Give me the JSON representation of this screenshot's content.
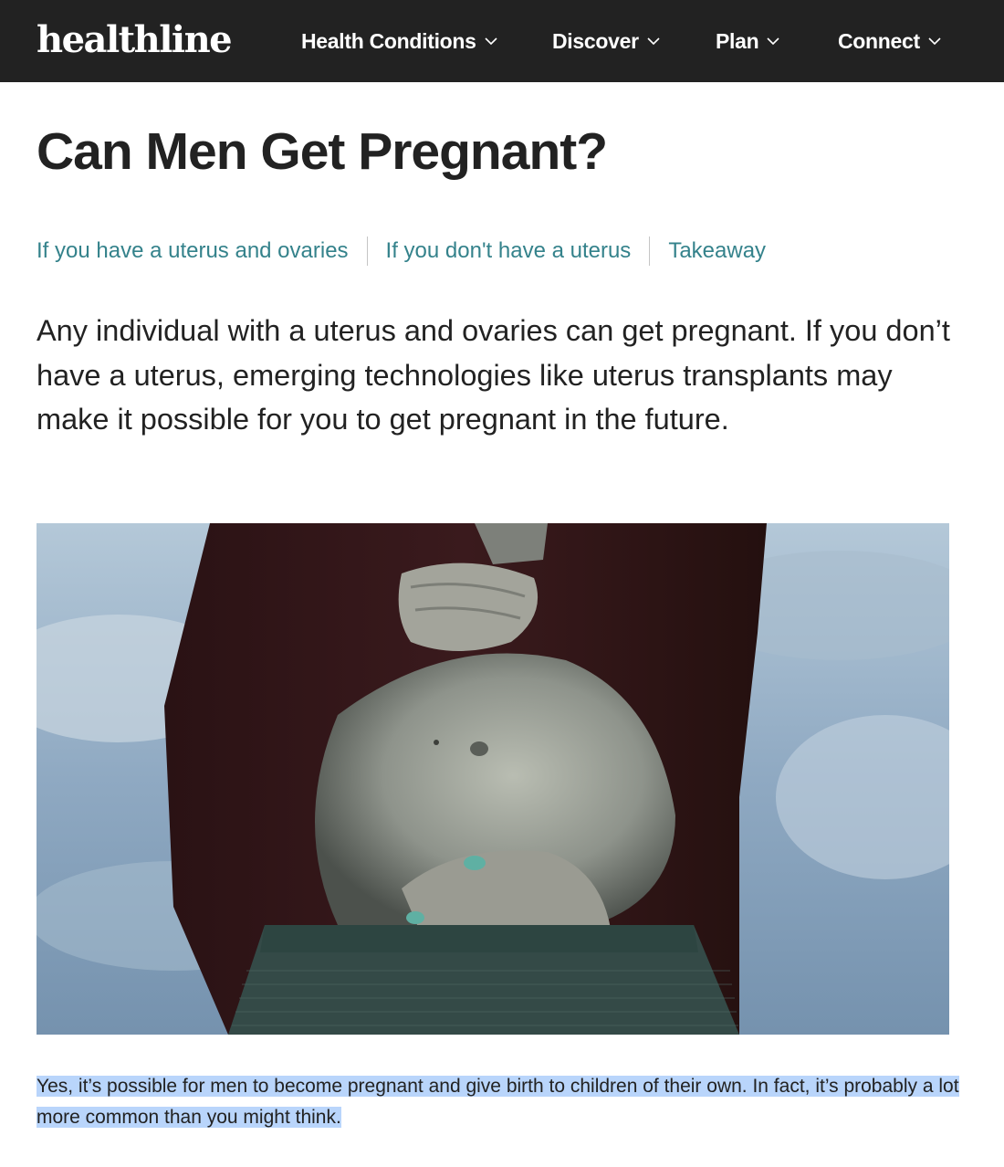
{
  "site": {
    "logo": "healthline"
  },
  "nav": {
    "items": [
      {
        "label": "Health Conditions"
      },
      {
        "label": "Discover"
      },
      {
        "label": "Plan"
      },
      {
        "label": "Connect"
      }
    ]
  },
  "article": {
    "title": "Can Men Get Pregnant?",
    "toc": [
      {
        "label": "If you have a uterus and ovaries"
      },
      {
        "label": "If you don't have a uterus"
      },
      {
        "label": "Takeaway"
      }
    ],
    "intro": "Any individual with a uterus and ovaries can get pregnant. If you don’t have a uterus, emerging technologies like uterus transplants may make it possible for you to get pregnant in the future.",
    "body": "Yes, it’s possible for men to become pregnant and give birth to children of their own. In fact, it’s probably a lot more common than you might think."
  },
  "colors": {
    "header_bg": "#222222",
    "link": "#34828b",
    "selection": "#b9d5fb",
    "text": "#222222"
  },
  "icons": {
    "nav_dropdown": "chevron-down-icon"
  }
}
